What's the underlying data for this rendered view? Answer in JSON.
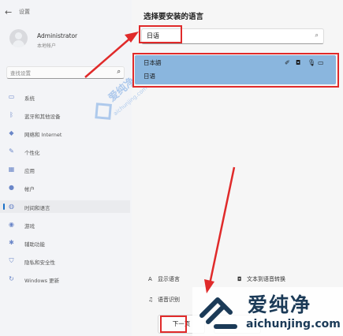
{
  "settings": {
    "window_title": "设置",
    "user": {
      "name": "Administrator",
      "subtitle": "本地帐户"
    },
    "search_placeholder": "查找设置",
    "nav": [
      {
        "label": "系统",
        "icon": "monitor-icon"
      },
      {
        "label": "蓝牙和其他设备",
        "icon": "bluetooth-icon"
      },
      {
        "label": "网络和 Internet",
        "icon": "wifi-icon"
      },
      {
        "label": "个性化",
        "icon": "brush-icon"
      },
      {
        "label": "应用",
        "icon": "apps-icon"
      },
      {
        "label": "帐户",
        "icon": "person-icon"
      },
      {
        "label": "时间和语言",
        "icon": "globe-clock-icon",
        "active": true
      },
      {
        "label": "游戏",
        "icon": "gamepad-icon"
      },
      {
        "label": "辅助功能",
        "icon": "accessibility-icon"
      },
      {
        "label": "隐私和安全性",
        "icon": "shield-icon"
      },
      {
        "label": "Windows 更新",
        "icon": "update-icon"
      }
    ]
  },
  "dialog": {
    "title": "选择要安装的语言",
    "search_value": "日语",
    "result": {
      "name": "日本語",
      "native": "日语",
      "feature_icons": [
        "language-pack-icon",
        "text-to-speech-icon",
        "speech-icon",
        "handwriting-icon"
      ]
    },
    "options": {
      "display_language": "显示语言",
      "text_to_speech": "文本到语音转换",
      "speech_recognition": "语音识别"
    },
    "next_button": "下一页"
  },
  "watermark": {
    "brand": "爱纯净",
    "domain": "aichunjing.com",
    "mid_brand": "爱纯净",
    "mid_domain": "aichunjing.com"
  },
  "colors": {
    "highlight": "#e02a2a",
    "selection": "#8ab6de",
    "accent": "#1a6fc7"
  }
}
